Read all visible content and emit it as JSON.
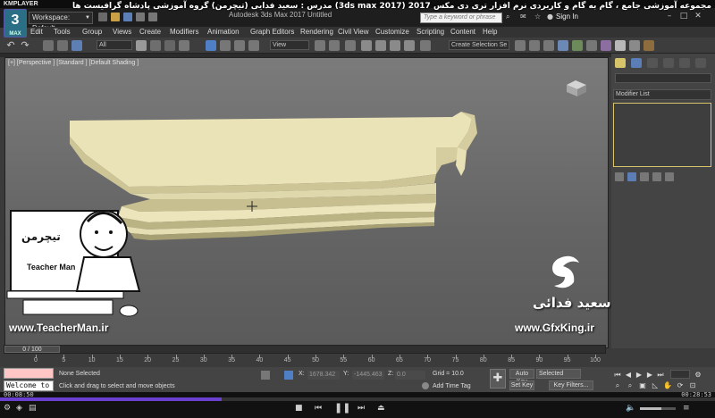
{
  "player": {
    "logo": "KMPLAYER",
    "logo_right": "BOX",
    "headline": "مجموعه آموزشی جامع ، گام به گام و کاربردی نرم افزار تری دی مکس 2017 (3ds max 2017)  مدرس : سعید فدایی (تیچرمن) گروه آموزشی پادشاه گرافیست ها",
    "time_elapsed": "00:08:50",
    "time_total": "00:28:53",
    "progress": 0.31
  },
  "app": {
    "logo_number": "3",
    "logo_text": "MAX",
    "workspace": "Workspace: Default",
    "title": "Autodesk 3ds Max 2017   Untitled",
    "search_placeholder": "Type a keyword or phrase",
    "sign_in": "Sign In"
  },
  "menu": [
    "Edit",
    "Tools",
    "Group",
    "Views",
    "Create",
    "Modifiers",
    "Animation",
    "Graph Editors",
    "Rendering",
    "Civil View",
    "Customize",
    "Scripting",
    "Content",
    "Help"
  ],
  "toolbar": {
    "filter": "All",
    "ref_coord": "View",
    "selection_set": "Create Selection Se"
  },
  "viewport": {
    "label": "[+] [Perspective ] [Standard ] [Default Shading ]"
  },
  "command_panel": {
    "modifier_list": "Modifier List"
  },
  "timeline": {
    "frame_display": "0 / 100",
    "ticks": [
      "0",
      "5",
      "10",
      "15",
      "20",
      "25",
      "30",
      "35",
      "40",
      "45",
      "50",
      "55",
      "60",
      "65",
      "70",
      "75",
      "80",
      "85",
      "90",
      "95",
      "100"
    ]
  },
  "status": {
    "script_listener": "Welcome to M",
    "selection": "None Selected",
    "prompt": "Click and drag to select and move objects",
    "x_label": "X:",
    "x_value": "1678.342",
    "y_label": "Y:",
    "y_value": "-1445.463",
    "z_label": "Z:",
    "z_value": "0.0",
    "grid": "Grid = 10.0",
    "add_time_tag": "Add Time Tag",
    "auto_key": "Auto Key",
    "set_key": "Set Key",
    "selected": "Selected",
    "key_filters": "Key Filters..."
  },
  "overlays": {
    "teacher_logo_fa": "تیچرمن",
    "teacher_sub": "Teacher Man",
    "url_left": "www.TeacherMan.ir",
    "name_fa": "سعید فدائی",
    "url_right": "www.GfxKing.ir"
  },
  "colors": {
    "viewport_bg": "#707070",
    "model": "#e7dfb3",
    "selection_highlight": "#d6c36a",
    "progress": "#6b3fcf"
  }
}
